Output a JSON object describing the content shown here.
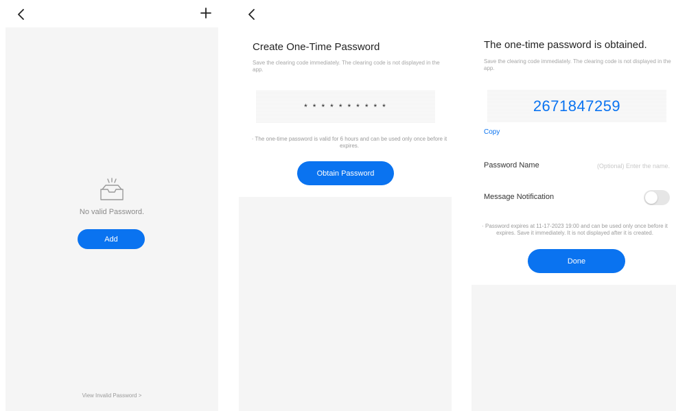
{
  "colors": {
    "accent": "#0a73f0",
    "panel_bg": "#f5f5f5",
    "muted_text": "#9a9a9a"
  },
  "panel1": {
    "back_icon": "chevron-left-icon",
    "add_icon": "plus-icon",
    "empty_icon": "empty-inbox-icon",
    "empty_text": "No valid Password.",
    "add_button": "Add",
    "view_invalid_link": "View Invalid Password >"
  },
  "panel2": {
    "back_icon": "chevron-left-icon",
    "title": "Create One-Time Password",
    "subtitle": "Save the clearing code immediately. The clearing code is not displayed in the app.",
    "masked_code": "**********",
    "note": "· The one-time password is valid for 6 hours and can be used only once before it expires.",
    "obtain_button": "Obtain Password"
  },
  "panel3": {
    "title": "The one-time password is obtained.",
    "subtitle": "Save the clearing code immediately. The clearing code is not displayed in the app.",
    "code": "2671847259",
    "copy_link": "Copy",
    "password_name_label": "Password Name",
    "password_name_placeholder": "(Optional) Enter the name.",
    "message_notification_label": "Message Notification",
    "message_notification_on": false,
    "note": "· Password expires at 11-17-2023 19:00 and can be used only once before it expires. Save it immediately. It is not displayed after it is created.",
    "done_button": "Done"
  }
}
